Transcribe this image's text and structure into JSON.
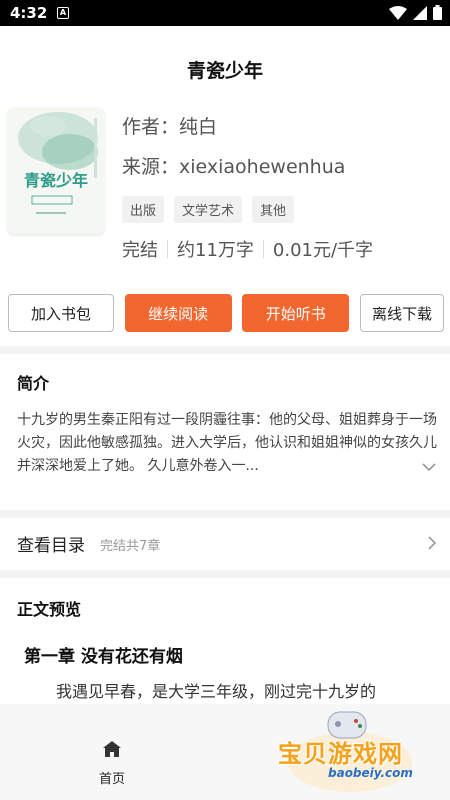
{
  "status": {
    "time": "4:32",
    "app_icon_letter": "A"
  },
  "book": {
    "title": "青瓷少年",
    "author": "作者：纯白",
    "source": "来源：xiexiaohewenhua",
    "tags": [
      "出版",
      "文学艺术",
      "其他"
    ],
    "status": "完结",
    "word_count": "约11万字",
    "price": "0.01元/千字"
  },
  "actions": {
    "add_shelf": "加入书包",
    "continue_reading": "继续阅读",
    "start_listen": "开始听书",
    "offline_download": "离线下载"
  },
  "intro": {
    "heading": "简介",
    "text": "十九岁的男生秦正阳有过一段阴霾往事：他的父母、姐姐葬身于一场火灾，因此他敏感孤独。进入大学后，他认识和姐姐神似的女孩久儿并深深地爱上了她。 久儿意外卷入一..."
  },
  "toc": {
    "label": "查看目录",
    "sub": "完结共7章"
  },
  "preview": {
    "heading": "正文预览",
    "chapter_title": "第一章 没有花还有烟",
    "first_line": "我遇见早春，是大学三年级，刚过完十九岁的"
  },
  "nav": {
    "home_label": "首页"
  },
  "colors": {
    "accent": "#f2672f",
    "background": "#ffffff"
  }
}
